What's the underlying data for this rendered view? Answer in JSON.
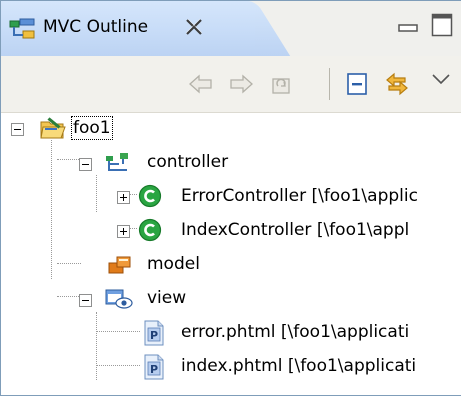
{
  "view": {
    "tab_title": "MVC Outline"
  },
  "icons": {
    "tab": "mvc-outline-view-icon",
    "close": "close-icon",
    "minimize": "minimize-icon",
    "maximize": "maximize-icon",
    "back": "back-arrow-icon",
    "forward": "forward-arrow-icon",
    "home": "home-icon",
    "collapse_all": "collapse-all-icon",
    "link_editor": "link-with-editor-icon",
    "view_menu": "view-menu-chevron-icon"
  },
  "tree": {
    "root": {
      "label": "foo1"
    },
    "controller": {
      "label": "controller"
    },
    "error_controller": {
      "label": "ErrorController  [\\foo1\\applic"
    },
    "index_controller": {
      "label": "IndexController  [\\foo1\\appl"
    },
    "model": {
      "label": "model"
    },
    "view": {
      "label": "view"
    },
    "error_phtml": {
      "label": "error.phtml  [\\foo1\\applicati"
    },
    "index_phtml": {
      "label": "index.phtml  [\\foo1\\applicati"
    }
  },
  "colors": {
    "tab_active": "#c6dbf7",
    "toolbar_bg": "#f2f1ec",
    "class_icon_green": "#1f9a33",
    "model_orange": "#e07b1a"
  }
}
